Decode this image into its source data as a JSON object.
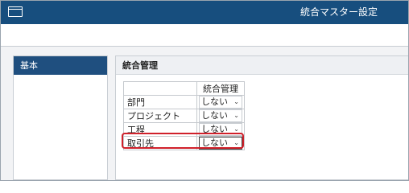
{
  "window": {
    "title": "統合マスター設定"
  },
  "sidebar": {
    "items": [
      {
        "label": "基本"
      }
    ]
  },
  "panel": {
    "title": "統合管理",
    "table": {
      "header": [
        "",
        "統合管理"
      ],
      "rows": [
        {
          "name": "部門",
          "value": "しない"
        },
        {
          "name": "プロジェクト",
          "value": "しない"
        },
        {
          "name": "工程",
          "value": "しない"
        },
        {
          "name": "取引先",
          "value": "しない"
        }
      ]
    }
  },
  "colors": {
    "titlebar": "#174e7e",
    "sidebar_active": "#1f4f7f",
    "highlight": "#d0202a"
  },
  "icons": {
    "window": "window-icon",
    "dropdown": "chevron-down-icon"
  }
}
